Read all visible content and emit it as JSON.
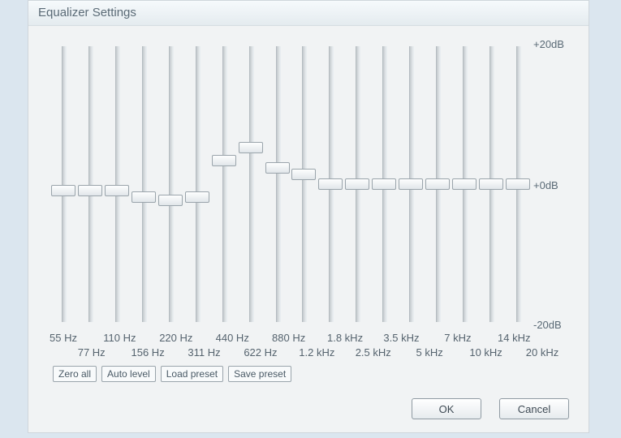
{
  "title": "Equalizer Settings",
  "scale": {
    "top": "+20dB",
    "mid": "+0dB",
    "bottom": "-20dB"
  },
  "bands": [
    {
      "freq": "55 Hz",
      "db": -1.0
    },
    {
      "freq": "77 Hz",
      "db": -1.0
    },
    {
      "freq": "110 Hz",
      "db": -1.0
    },
    {
      "freq": "156 Hz",
      "db": -2.0
    },
    {
      "freq": "220 Hz",
      "db": -2.5
    },
    {
      "freq": "311 Hz",
      "db": -2.0
    },
    {
      "freq": "440 Hz",
      "db": 3.5
    },
    {
      "freq": "622 Hz",
      "db": 5.5
    },
    {
      "freq": "880 Hz",
      "db": 2.5
    },
    {
      "freq": "1.2 kHz",
      "db": 1.5
    },
    {
      "freq": "1.8 kHz",
      "db": 0.0
    },
    {
      "freq": "2.5 kHz",
      "db": 0.0
    },
    {
      "freq": "3.5 kHz",
      "db": 0.0
    },
    {
      "freq": "5 kHz",
      "db": 0.0
    },
    {
      "freq": "7 kHz",
      "db": 0.0
    },
    {
      "freq": "10 kHz",
      "db": 0.0
    },
    {
      "freq": "14 kHz",
      "db": 0.0
    },
    {
      "freq": "20 kHz",
      "db": 0.0
    }
  ],
  "buttons": {
    "zero_all": "Zero all",
    "auto_level": "Auto level",
    "load_preset": "Load preset",
    "save_preset": "Save preset",
    "ok": "OK",
    "cancel": "Cancel"
  },
  "slider_geom": {
    "track_h": 340,
    "thumb_h": 14,
    "db_min": -20,
    "db_max": 20
  }
}
